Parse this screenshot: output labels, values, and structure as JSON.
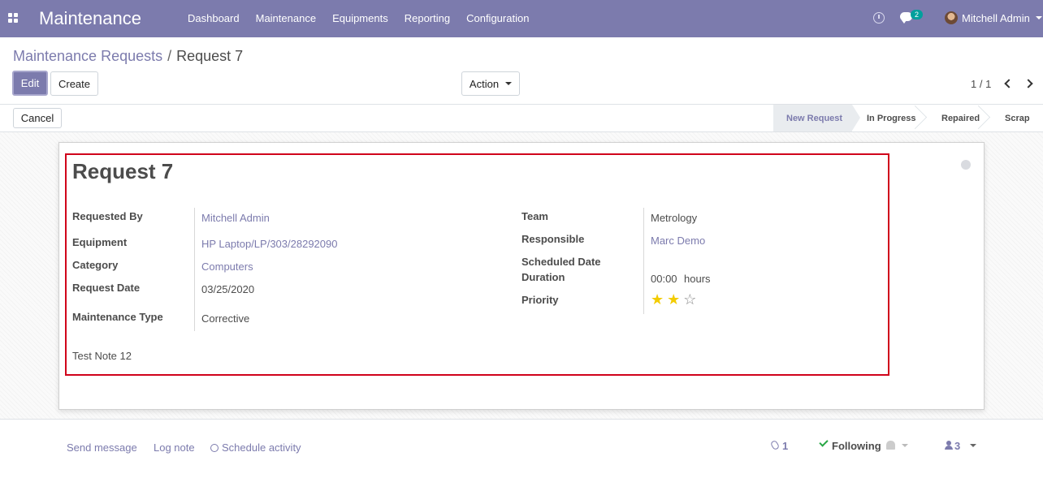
{
  "navbar": {
    "app_title": "Maintenance",
    "menu": [
      "Dashboard",
      "Maintenance",
      "Equipments",
      "Reporting",
      "Configuration"
    ],
    "messages_badge": "2",
    "user_name": "Mitchell Admin",
    "color": "#7c7bad"
  },
  "breadcrumb": {
    "parent": "Maintenance Requests",
    "separator": "/",
    "current": "Request 7"
  },
  "buttons": {
    "edit": "Edit",
    "create": "Create",
    "action": "Action",
    "cancel": "Cancel"
  },
  "pager": {
    "value": "1 / 1"
  },
  "stages": [
    "New Request",
    "In Progress",
    "Repaired",
    "Scrap"
  ],
  "active_stage": "New Request",
  "form": {
    "title": "Request 7",
    "left": {
      "requested_by_label": "Requested By",
      "requested_by": "Mitchell Admin",
      "equipment_label": "Equipment",
      "equipment": "HP Laptop/LP/303/28292090",
      "category_label": "Category",
      "category": "Computers",
      "request_date_label": "Request Date",
      "request_date": "03/25/2020",
      "maintenance_type_label": "Maintenance Type",
      "maintenance_type": "Corrective"
    },
    "right": {
      "team_label": "Team",
      "team": "Metrology",
      "responsible_label": "Responsible",
      "responsible": "Marc Demo",
      "scheduled_date_label": "Scheduled Date",
      "duration_label": "Duration",
      "duration": "00:00",
      "duration_unit": "hours",
      "priority_label": "Priority",
      "priority": 2,
      "priority_max": 3
    },
    "note": "Test Note 12"
  },
  "chatter": {
    "send_message": "Send message",
    "log_note": "Log note",
    "schedule_activity": "Schedule activity",
    "attachments": "1",
    "following": "Following",
    "followers": "3"
  }
}
